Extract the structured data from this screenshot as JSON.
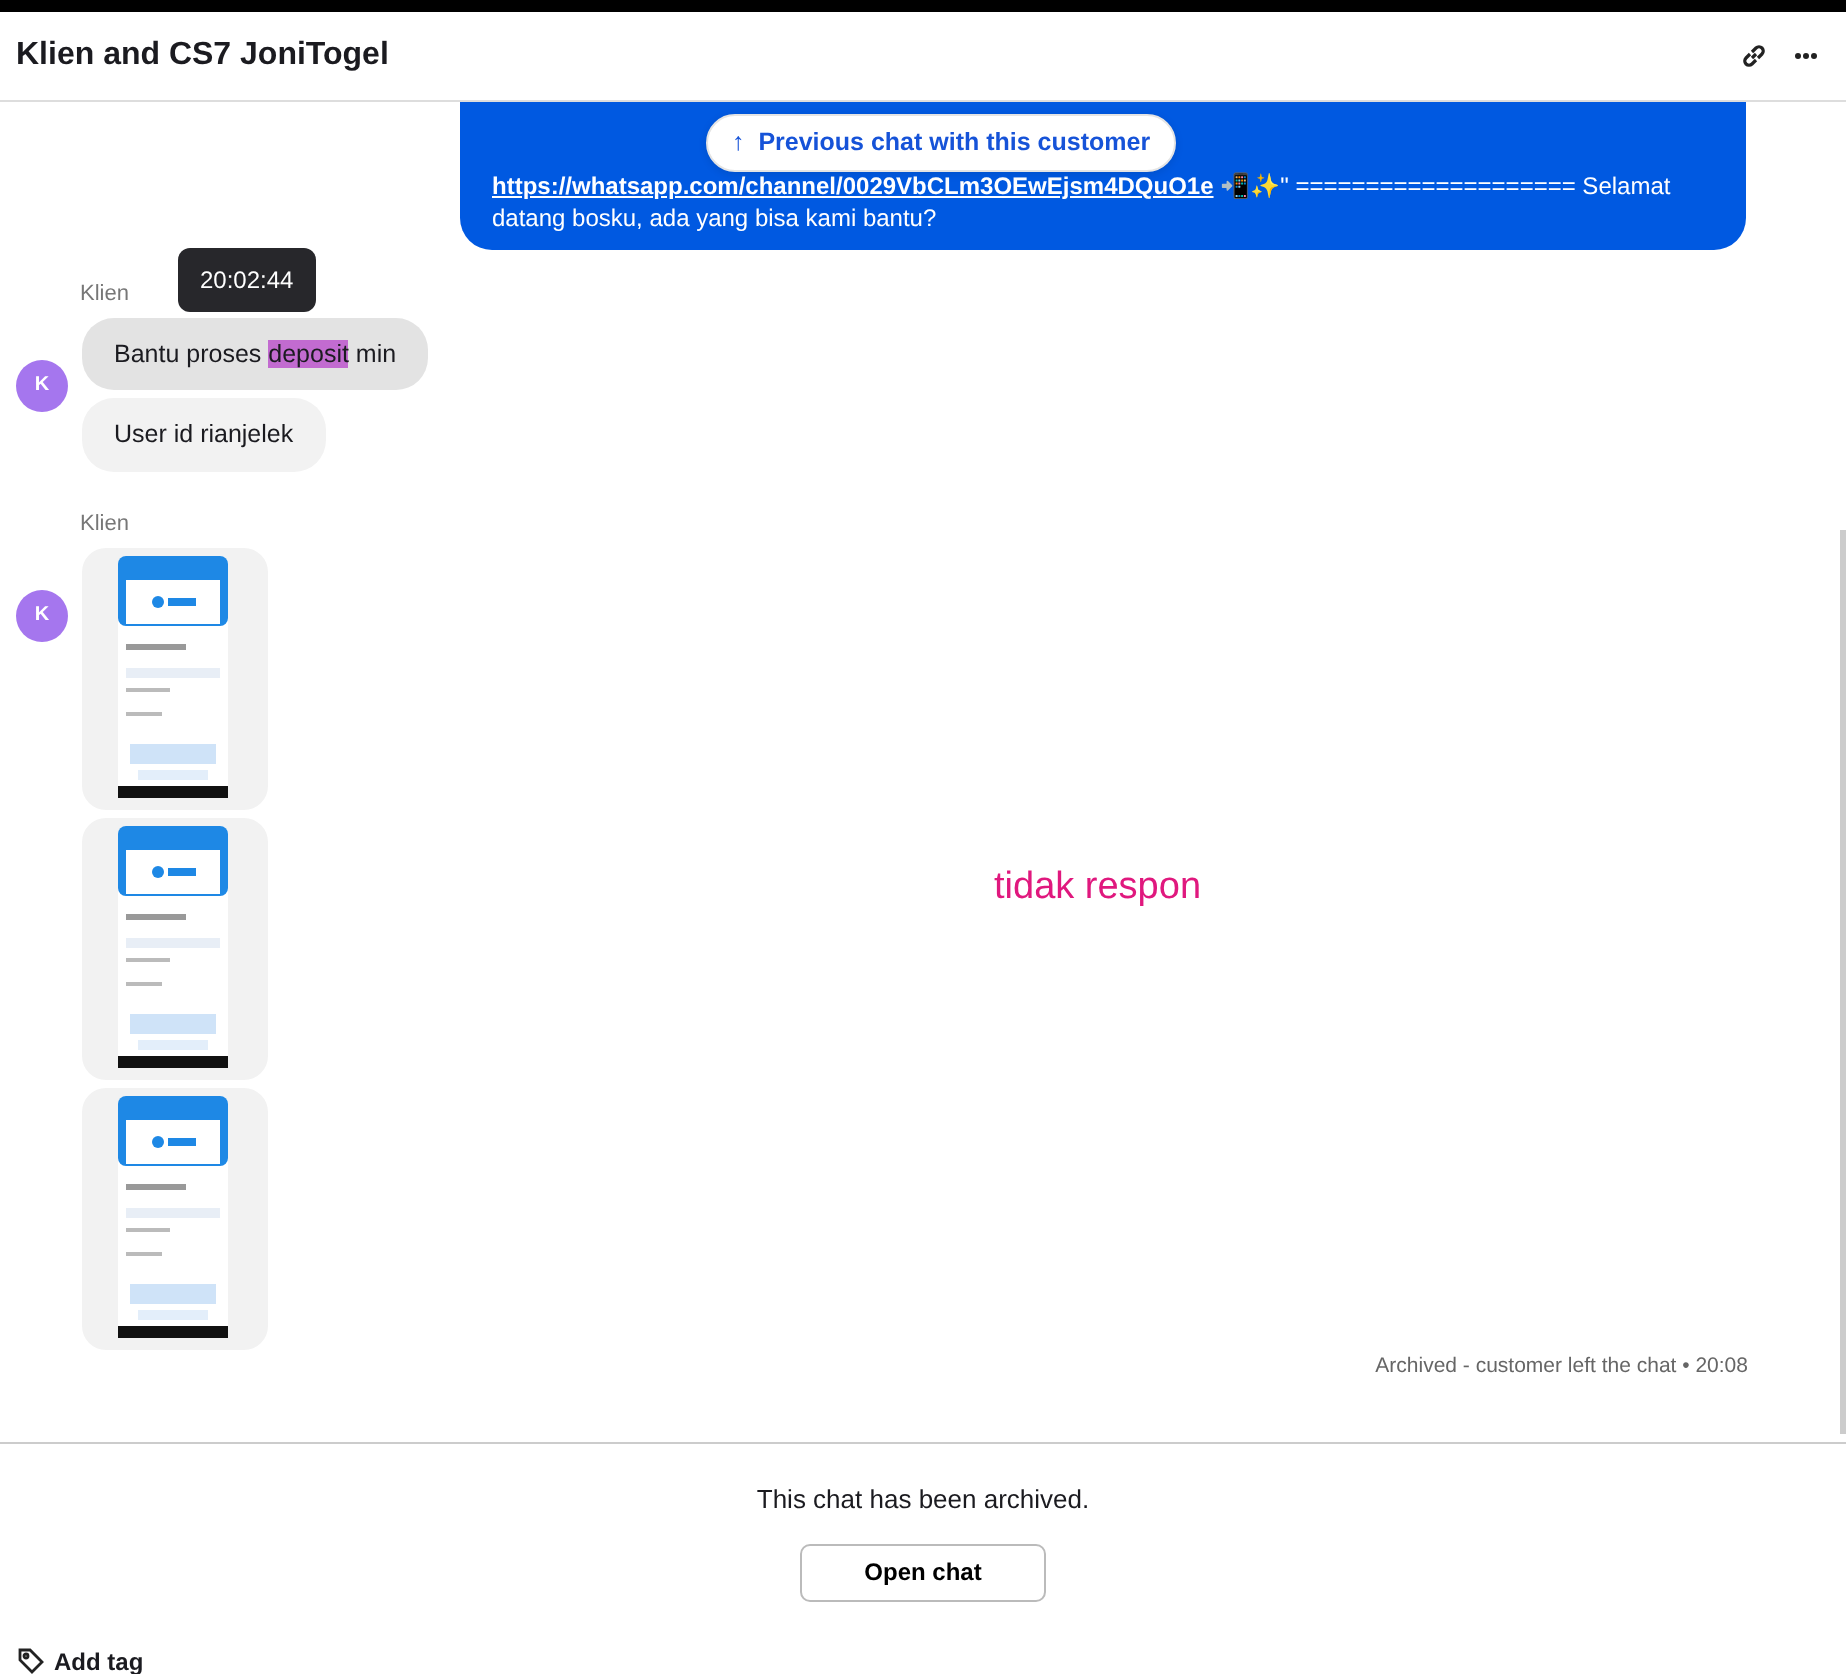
{
  "header": {
    "title": "Klien and CS7 JoniTogel"
  },
  "previous_chat_button": {
    "icon": "↑",
    "label": "Previous chat with this customer"
  },
  "messages": [
    {
      "kind": "agent",
      "link": "https://whatsapp.com/channel/0029VbCLm3OEwEjsm4DQuO1e",
      "text": " 📲✨\" ==================== Selamat datang bosku, ada yang bisa kami bantu?"
    },
    {
      "kind": "customer_text",
      "sender": "Klien",
      "avatar": "K",
      "tooltip": "20:02:44",
      "bubbles": [
        {
          "hovered": true,
          "parts": [
            {
              "text": "Bantu proses ",
              "highlighted": false
            },
            {
              "text": "deposit",
              "highlighted": true
            },
            {
              "text": " min",
              "highlighted": false
            }
          ]
        },
        {
          "hovered": false,
          "parts": [
            {
              "text": "User id rianjelek",
              "highlighted": false
            }
          ]
        }
      ]
    },
    {
      "kind": "customer_images",
      "sender": "Klien",
      "avatar": "K"
    }
  ],
  "annotation": "tidak respon",
  "status_line": "Archived - customer left the chat • 20:08",
  "footer": {
    "notice": "This chat has been archived.",
    "button": "Open chat",
    "add_tag": "Add tag"
  }
}
